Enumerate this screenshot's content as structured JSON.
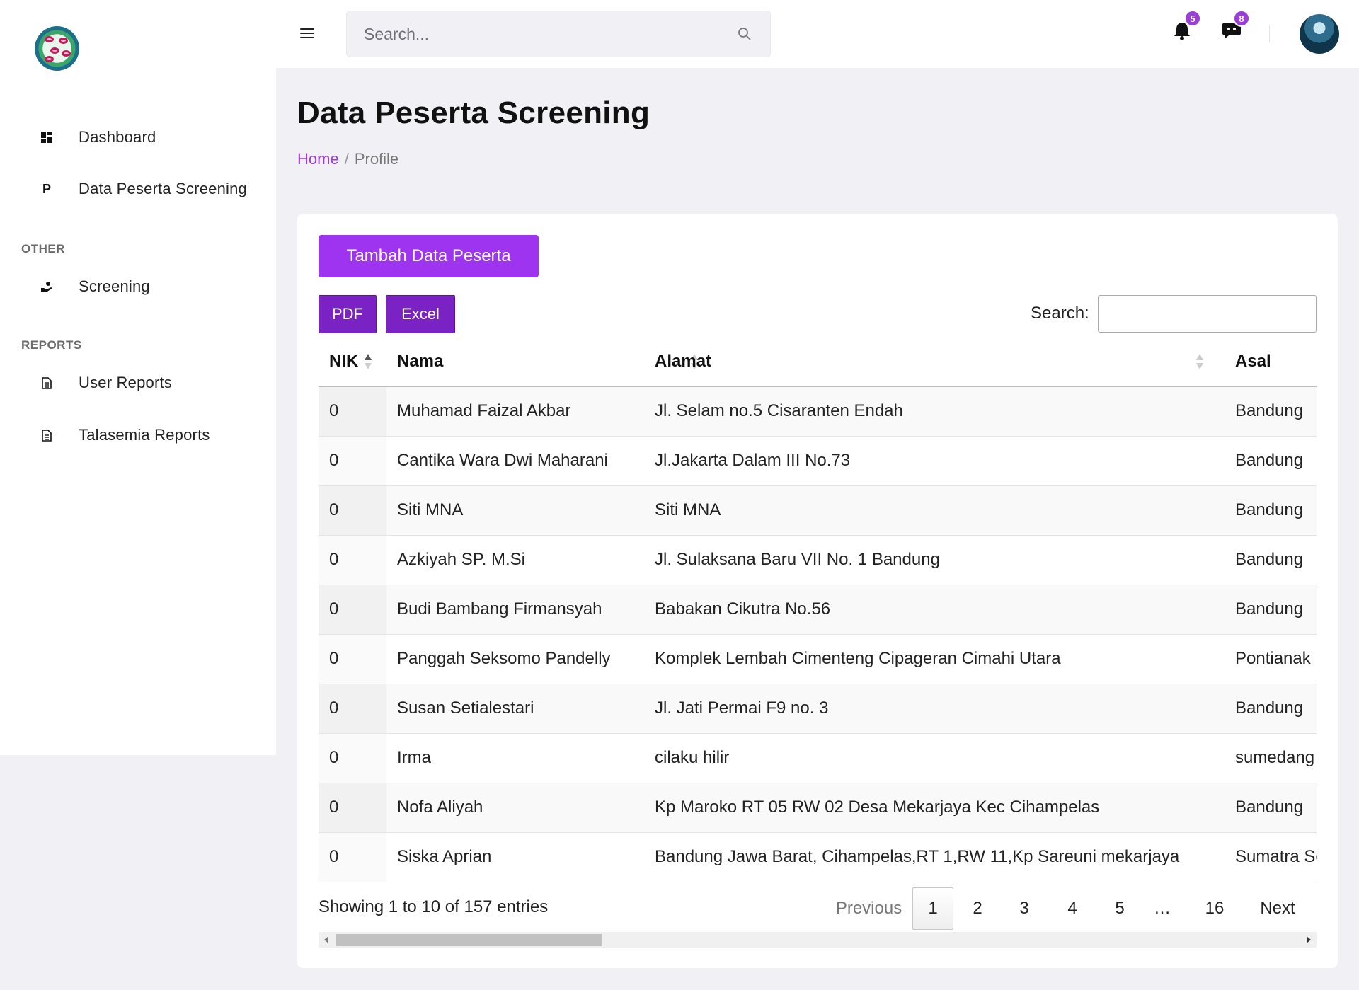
{
  "sidebar": {
    "items": [
      {
        "label": "Dashboard",
        "icon": "dashboard-icon"
      },
      {
        "label": "Data Peserta Screening",
        "icon": "letter-p-icon",
        "glyph": "P"
      },
      {
        "label": "Screening",
        "icon": "hand-holding-icon"
      },
      {
        "label": "User Reports",
        "icon": "document-icon"
      },
      {
        "label": "Talasemia Reports",
        "icon": "document-icon"
      }
    ],
    "sections": {
      "other": "OTHER",
      "reports": "REPORTS"
    }
  },
  "topbar": {
    "search_placeholder": "Search...",
    "notifications_count": "5",
    "messages_count": "8"
  },
  "page": {
    "title": "Data Peserta Screening",
    "breadcrumb": {
      "home": "Home",
      "separator": "/",
      "current": "Profile"
    }
  },
  "card": {
    "add_button": "Tambah Data Peserta",
    "export_pdf": "PDF",
    "export_excel": "Excel",
    "search_label": "Search:"
  },
  "table": {
    "columns": [
      "NIK",
      "Nama",
      "Alamat",
      "Asal"
    ],
    "rows": [
      [
        "0",
        "Muhamad Faizal Akbar",
        "Jl. Selam no.5 Cisaranten Endah",
        "Bandung"
      ],
      [
        "0",
        "Cantika Wara Dwi Maharani",
        "Jl.Jakarta Dalam III No.73",
        "Bandung"
      ],
      [
        "0",
        "Siti MNA",
        "Siti MNA",
        "Bandung"
      ],
      [
        "0",
        "Azkiyah SP. M.Si",
        "Jl. Sulaksana Baru VII No. 1 Bandung",
        "Bandung"
      ],
      [
        "0",
        "Budi Bambang Firmansyah",
        "Babakan Cikutra No.56",
        "Bandung"
      ],
      [
        "0",
        "Panggah Seksomo Pandelly",
        "Komplek Lembah Cimenteng Cipageran Cimahi Utara",
        "Pontianak"
      ],
      [
        "0",
        "Susan Setialestari",
        "Jl. Jati Permai F9 no. 3",
        "Bandung"
      ],
      [
        "0",
        "Irma",
        "cilaku hilir",
        "sumedang"
      ],
      [
        "0",
        "Nofa Aliyah",
        "Kp Maroko RT 05 RW 02 Desa Mekarjaya Kec Cihampelas",
        "Bandung"
      ],
      [
        "0",
        "Siska Aprian",
        "Bandung Jawa Barat, Cihampelas,RT 1,RW 11,Kp Sareuni mekarjaya",
        "Sumatra Selatan"
      ]
    ]
  },
  "pagination": {
    "info": "Showing 1 to 10 of 157 entries",
    "previous": "Previous",
    "pages": [
      "1",
      "2",
      "3",
      "4",
      "5",
      "…",
      "16"
    ],
    "current": "1",
    "next": "Next"
  },
  "colors": {
    "accent": "#9f34f0",
    "export_button": "#7b22c4",
    "badge": "#9b3dd6"
  }
}
